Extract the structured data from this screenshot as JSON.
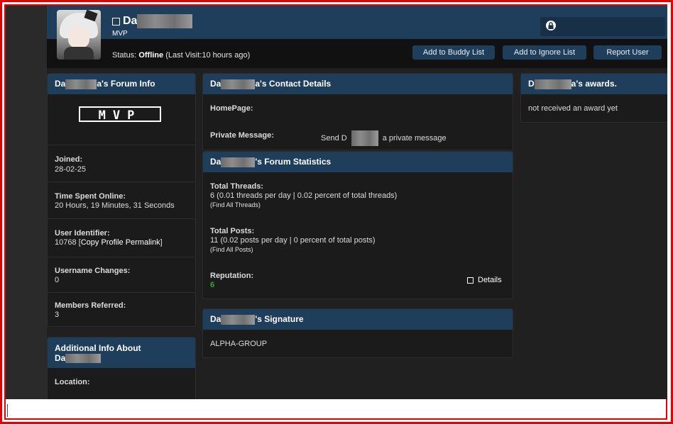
{
  "header": {
    "username_visible": "Da",
    "user_title": "MVP",
    "status_label": "Status:",
    "status_value": "Offline",
    "last_visit": "(Last Visit:10 hours ago)",
    "buttons": {
      "buddy": "Add to Buddy List",
      "ignore": "Add to Ignore List",
      "report": "Report User"
    }
  },
  "forum_info": {
    "title_prefix": "Da",
    "title_mid": "a",
    "title_suffix": "'s Forum Info",
    "badge": "MVP",
    "joined_label": "Joined:",
    "joined_value": "28-02-25",
    "time_online_label": "Time Spent Online:",
    "time_online_value": "20 Hours, 19 Minutes, 31 Seconds",
    "uid_label": "User Identifier:",
    "uid_value": "10768",
    "uid_link": "Copy Profile Permalink",
    "uname_changes_label": "Username Changes:",
    "uname_changes_value": "0",
    "referred_label": "Members Referred:",
    "referred_value": "3"
  },
  "additional": {
    "title_line1": "Additional Info About",
    "title_line2": "Da",
    "location_label": "Location:"
  },
  "contact": {
    "title_prefix": "Da",
    "title_suffix": "a's Contact Details",
    "homepage_label": "HomePage:",
    "pm_label": "Private Message:",
    "pm_send": "Send D",
    "pm_suffix": "a private message"
  },
  "stats": {
    "title_prefix": "Da",
    "title_suffix": "'s Forum Statistics",
    "threads_label": "Total Threads:",
    "threads_value": "6 (0.01 threads per day | 0.02 percent of total threads)",
    "threads_link": "(Find All Threads)",
    "posts_label": "Total Posts:",
    "posts_value": "11 (0.02 posts per day | 0 percent of total posts)",
    "posts_link": "(Find All Posts)",
    "rep_label": "Reputation:",
    "rep_value": "6",
    "details": "Details"
  },
  "signature": {
    "title_prefix": "Da",
    "title_suffix": "'s Signature",
    "text": "ALPHA-GROUP"
  },
  "awards": {
    "title_prefix": "D",
    "title_suffix": "a's awards.",
    "text": "not received an award yet"
  },
  "colors": {
    "accent": "#1f3e5c",
    "background": "#202020",
    "reputation": "#3aa43a",
    "frame": "#e60000"
  }
}
